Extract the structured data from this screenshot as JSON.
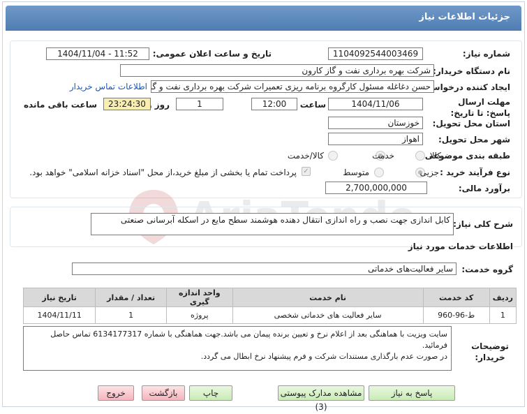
{
  "header": {
    "title": "جزئیات اطلاعات نیاز"
  },
  "labels": {
    "need_number": "شماره نیاز:",
    "announce_datetime": "تاریخ و ساعت اعلان عمومی:",
    "buyer_org": "نام دستگاه خریدار:",
    "requester": "ایجاد کننده درخواست:",
    "deadline": "مهلت ارسال پاسخ: تا تاریخ:",
    "time": "ساعت",
    "day_and": "روز و",
    "remaining": "ساعت باقی مانده",
    "province": "استان محل تحویل:",
    "city": "شهر محل تحویل:",
    "category": "طبقه بندی موضوعی:",
    "process_type": "نوع فرآیند خرید :",
    "estimate": "برآورد مالی:",
    "general_desc": "شرح کلی نیاز:",
    "services_title": "اطلاعات خدمات مورد نیاز",
    "service_group": "گروه خدمت:",
    "buyer_notes": "توضیحات خریدار:"
  },
  "values": {
    "need_number": "1104092544003469",
    "announce_datetime": "1404/11/04 - 11:52",
    "buyer_org": "شرکت بهره برداری نفت و گاز کارون",
    "requester": "حسن دغاغله مسئول کارگروه برنامه ریزی تعمیرات شرکت بهره برداری نفت و گاز",
    "contact_link": "اطلاعات تماس خریدار",
    "deadline_date": "1404/11/06",
    "deadline_time": "12:00",
    "days": "1",
    "remaining_time": "23:24:30",
    "province": "خوزستان",
    "city": "اهواز",
    "estimate": "2,700,000,000",
    "general_desc": "کابل اندازی جهت نصب و راه اندازی انتقال دهنده هوشمند سطح مایع در اسکله آبرسانی صنعتی",
    "service_group": "سایر فعالیت‌های خدماتی"
  },
  "category_options": {
    "goods": "کالا",
    "service": "خدمت",
    "goods_service": "کالا/خدمت",
    "selected": "service"
  },
  "process_options": {
    "partial": "جزیی",
    "medium": "متوسط",
    "selected": "partial"
  },
  "payment_note": "پرداخت تمام یا بخشی از مبلغ خرید،از محل \"اسناد خزانه اسلامی\" خواهد بود.",
  "table": {
    "headers": [
      "ردیف",
      "کد خدمت",
      "نام خدمت",
      "واحد اندازه گیری",
      "تعداد / مقدار",
      "تاریخ نیاز"
    ],
    "rows": [
      [
        "1",
        "ط-96-960",
        "سایر فعالیت های خدماتی شخصی",
        "پروژه",
        "1",
        "1404/11/11"
      ]
    ]
  },
  "notes": {
    "line1": "سایت ویزیت با هماهنگی بعد از اعلام نرخ و تعیین برنده پیمان می باشد.جهت هماهنگی با شماره 6134177317 تماس حاصل فرمائید.",
    "line2": "در صورت عدم بارگذاری مستندات شرکت و فرم پیشنهاد نرخ ابطال می گردد."
  },
  "buttons": {
    "reply": "پاسخ به نیاز",
    "view_docs": "مشاهده مدارک پیوستی (3)",
    "print": "چاپ",
    "back": "بازگشت",
    "exit": "خروج"
  },
  "watermark": "AriaTender.net",
  "colors": {
    "header": "#5a86ba",
    "green_button": "#c9ebb6",
    "pink_button": "#f4b4bd",
    "countdown": "#f7eeb0"
  }
}
